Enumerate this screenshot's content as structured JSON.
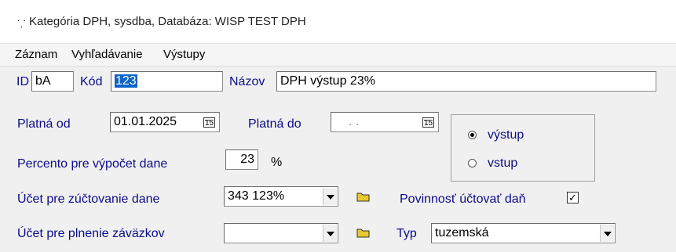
{
  "window": {
    "title": "Kategória DPH, sysdba,  Databáza: WISP TEST DPH",
    "icon": "app-icon"
  },
  "menu": {
    "items": [
      "Záznam",
      "Vyhľadávanie",
      "Výstupy"
    ]
  },
  "form": {
    "id_label": "ID",
    "id_value": "bA",
    "kod_label": "Kód",
    "kod_value": "123",
    "nazov_label": "Názov",
    "nazov_value": "DPH výstup 23%",
    "platna_od_label": "Platná od",
    "platna_od_value": "01.01.2025",
    "platna_do_label": "Platná do",
    "platna_do_value": " . .",
    "calendar_icon_glyph": "15",
    "percento_label": "Percento pre výpočet dane",
    "percento_value": "23",
    "percent_sign": "%",
    "direction": {
      "options": [
        "výstup",
        "vstup"
      ],
      "selected": "výstup"
    },
    "ucet_dane_label": "Účet pre zúčtovanie dane",
    "ucet_dane_value": "343 123%",
    "povinnost_label": "Povinnosť účtovať daň",
    "povinnost_checked": true,
    "check_glyph": "✓",
    "ucet_zavazok_label": "Účet pre plnenie záväzkov",
    "ucet_zavazok_value": "",
    "typ_label": "Typ",
    "typ_value": "tuzemská"
  },
  "colors": {
    "label": "#0c0c8a",
    "selection": "#0a64c8",
    "folder": "#e8c830"
  }
}
